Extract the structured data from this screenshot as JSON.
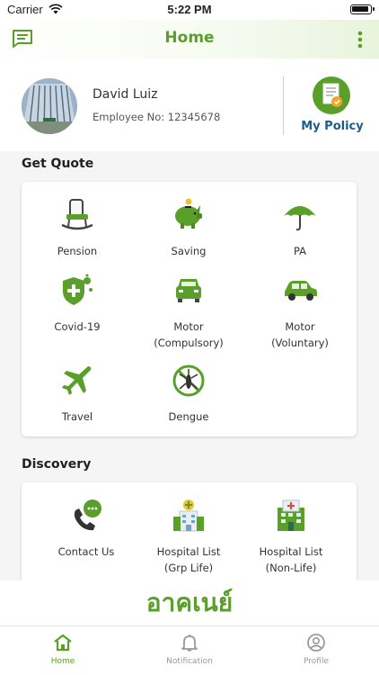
{
  "status_bar": {
    "carrier": "Carrier",
    "time": "5:22 PM"
  },
  "nav": {
    "title": "Home",
    "chat_icon": "chat-icon",
    "more_icon": "more-vert-icon"
  },
  "profile": {
    "name": "David Luiz",
    "employee_no": "Employee No: 12345678",
    "policy_label": "My Policy",
    "policy_icon": "document-icon"
  },
  "get_quote": {
    "title": "Get Quote",
    "items": [
      {
        "label": "Pension",
        "icon": "rocking-chair-icon"
      },
      {
        "label": "Saving",
        "icon": "piggy-bank-icon"
      },
      {
        "label": "PA",
        "icon": "umbrella-icon"
      },
      {
        "label": "Covid-19",
        "icon": "shield-plus-icon"
      },
      {
        "label": "Motor\n(Compulsory)",
        "icon": "car-icon"
      },
      {
        "label": "Motor\n(Voluntary)",
        "icon": "car-side-icon"
      },
      {
        "label": "Travel",
        "icon": "airplane-icon"
      },
      {
        "label": "Dengue",
        "icon": "mosquito-icon"
      }
    ]
  },
  "discovery": {
    "title": "Discovery",
    "items": [
      {
        "label": "Contact Us",
        "icon": "phone-chat-icon"
      },
      {
        "label": "Hospital List\n(Grp Life)",
        "icon": "hospital-icon"
      },
      {
        "label": "Hospital List\n(Non-Life)",
        "icon": "hospital-building-icon"
      }
    ]
  },
  "brand": {
    "text": "อาคเนย์"
  },
  "tabs": [
    {
      "label": "Home",
      "icon": "home-icon",
      "active": true
    },
    {
      "label": "Notification",
      "icon": "bell-icon",
      "active": false
    },
    {
      "label": "Profile",
      "icon": "profile-icon",
      "active": false
    }
  ],
  "colors": {
    "accent": "#5a9f2a",
    "policy_text": "#1e5c8c",
    "inactive": "#9a9a9a"
  }
}
